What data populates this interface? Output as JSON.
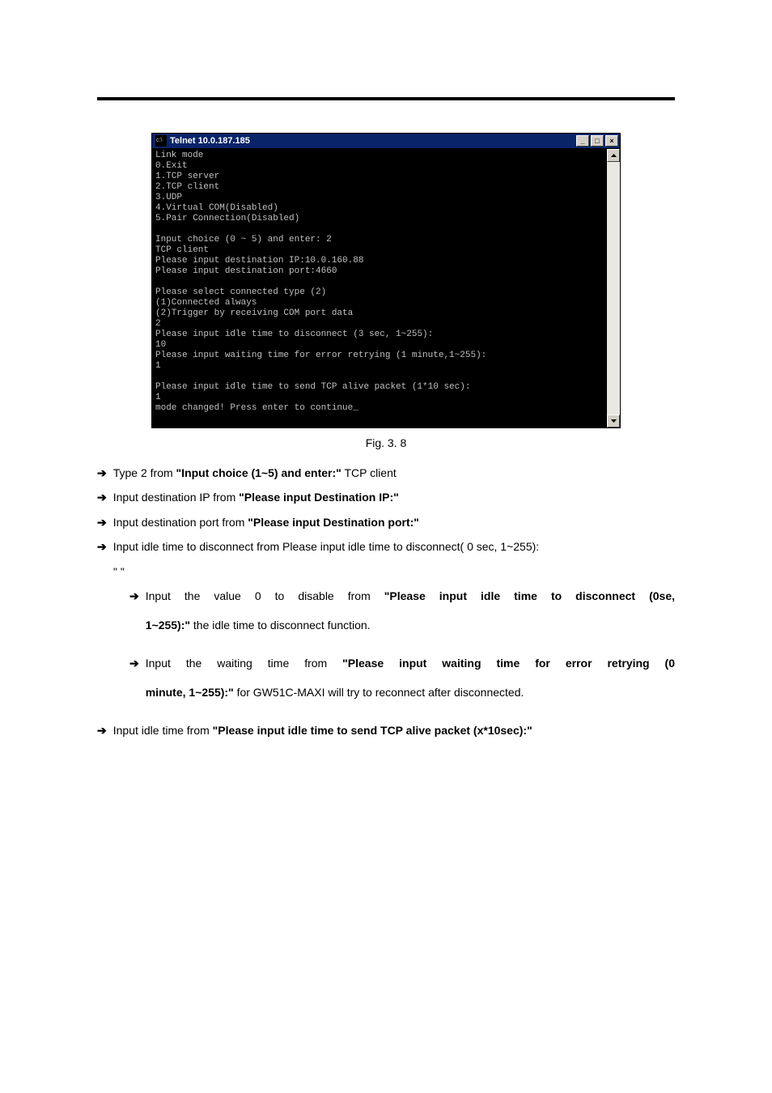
{
  "telnet": {
    "title": "Telnet 10.0.187.185",
    "terminal_lines": "Link mode\n0.Exit\n1.TCP server\n2.TCP client\n3.UDP\n4.Virtual COM(Disabled)\n5.Pair Connection(Disabled)\n\nInput choice (0 ~ 5) and enter: 2\nTCP client\nPlease input destination IP:10.0.160.88\nPlease input destination port:4660\n\nPlease select connected type (2)\n(1)Connected always\n(2)Trigger by receiving COM port data\n2\nPlease input idle time to disconnect (3 sec, 1~255):\n10\nPlease input waiting time for error retrying (1 minute,1~255):\n1\n\nPlease input idle time to send TCP alive packet (1*10 sec):\n1\nmode changed! Press enter to continue_",
    "min_label": "_",
    "max_label": "□",
    "close_label": "×",
    "scroll_up": "▲",
    "scroll_down": "▼"
  },
  "caption": "Fig. 3. 8",
  "lines": {
    "l1_pre": "Type 2 from ",
    "l1_bold": "\"Input choice (1~5) and enter:\"",
    "l1_post": " TCP client",
    "l2_pre": "Input destination IP from ",
    "l2_bold": "\"Please input Destination IP:\"",
    "l3_pre": "Input destination port from ",
    "l3_bold": "\"Please input Destination port:\"",
    "l4": "Input idle time to disconnect from Please input idle time to disconnect( 0 sec, 1~255):",
    "l4_quote": "\" \"",
    "l4a_pre": "Input the value 0 to disable from",
    "l4a_bold": "\"Please input idle time to disconnect (0se,",
    "l4a_bold2": "1~255):\"",
    "l4a_post": " the idle time to disconnect function.",
    "l4b_pre": "Input the waiting time from ",
    "l4b_bold": "\"Please input waiting time for error retrying (0",
    "l4b_bold2": "minute, 1~255):\"",
    "l4b_post": " for GW51C-MAXI will try to reconnect after disconnected.",
    "l5_pre": "Input idle time from ",
    "l5_bold": "\"Please input idle time to send TCP alive packet (x*10sec):\""
  }
}
